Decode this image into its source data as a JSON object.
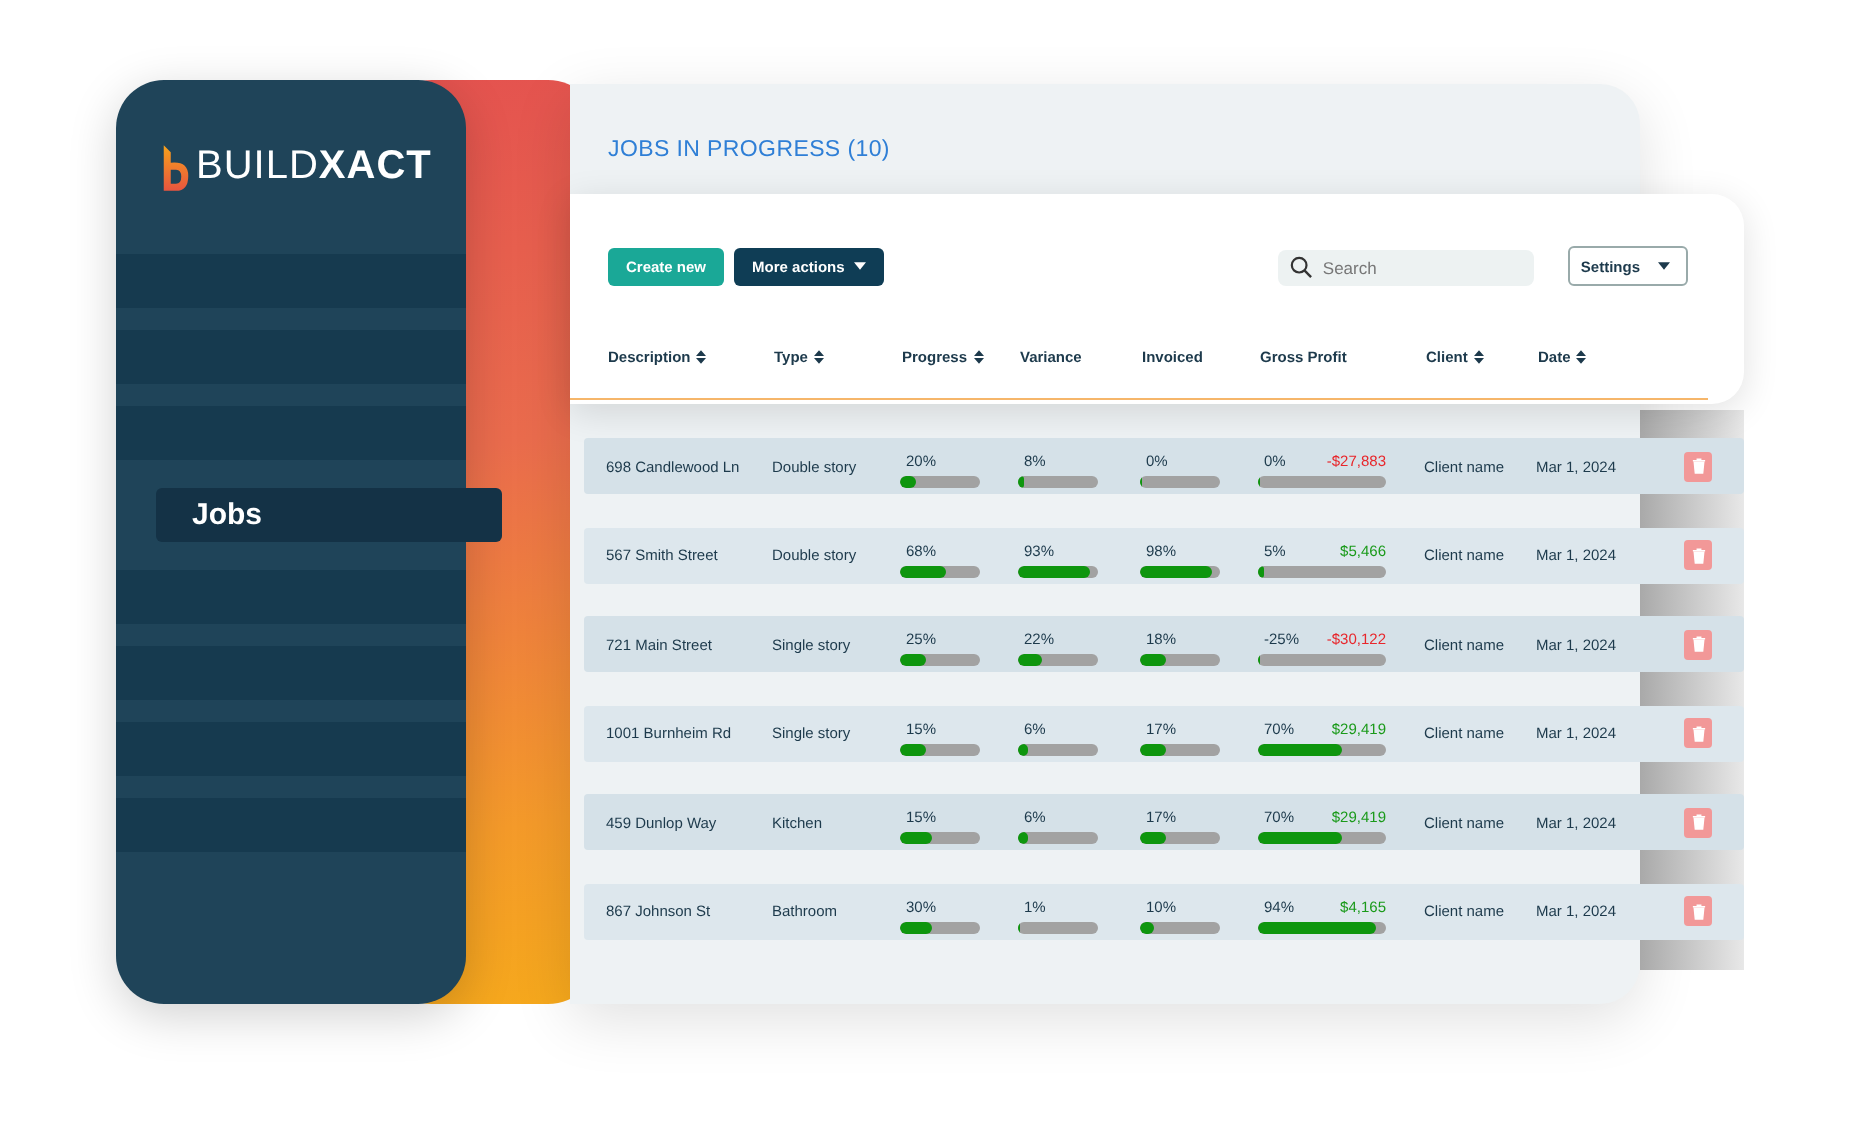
{
  "logo": {
    "text": "BUILD**XACT**"
  },
  "sidebar": {
    "items": [
      {
        "label": "Jobs",
        "selected": true
      }
    ]
  },
  "title": "JOBS IN PROGRESS (10)",
  "toolbar": {
    "create_button": "Create new",
    "actions_button": "More actions",
    "search": {
      "placeholder": "Search"
    },
    "settings_button": "Settings"
  },
  "table": {
    "columns": [
      {
        "label": "Description",
        "sortable": true
      },
      {
        "label": "Type",
        "sortable": true
      },
      {
        "label": "Progress",
        "sortable": true
      },
      {
        "label": "Variance",
        "sortable": false
      },
      {
        "label": "Invoiced",
        "sortable": false
      },
      {
        "label": "Gross Profit",
        "sortable": false
      },
      {
        "label": "Client",
        "sortable": true
      },
      {
        "label": "Date",
        "sortable": true
      }
    ],
    "rows": [
      {
        "description": "698 Candlewood Ln",
        "type": "Double story",
        "progress": {
          "text": "20%",
          "level": 0.2
        },
        "variance": {
          "text": "8%",
          "level": 0.08
        },
        "invoiced": {
          "text": "0%",
          "level": 0
        },
        "gross_profit": {
          "percent": "0%",
          "amount": "-$27,883",
          "color": "#e8262b",
          "level": 0
        },
        "client": "Client name",
        "date": "Mar 1, 2024"
      },
      {
        "description": "567 Smith Street",
        "type": "Double story",
        "progress": {
          "text": "68%",
          "level": 0.58
        },
        "variance": {
          "text": "93%",
          "level": 0.9
        },
        "invoiced": {
          "text": "98%",
          "level": 0.9
        },
        "gross_profit": {
          "percent": "5%",
          "amount": "$5,466",
          "color": "#1a9a1a",
          "level": 0.05
        },
        "client": "Client name",
        "date": "Mar 1, 2024"
      },
      {
        "description": "721 Main Street",
        "type": "Single story",
        "progress": {
          "text": "25%",
          "level": 0.32
        },
        "variance": {
          "text": "22%",
          "level": 0.3
        },
        "invoiced": {
          "text": "18%",
          "level": 0.32
        },
        "gross_profit": {
          "percent": "-25%",
          "amount": "-$30,122",
          "color": "#e8262b",
          "level": 0
        },
        "client": "Client name",
        "date": "Mar 1, 2024"
      },
      {
        "description": "1001 Burnheim Rd",
        "type": "Single story",
        "progress": {
          "text": "15%",
          "level": 0.32
        },
        "variance": {
          "text": "6%",
          "level": 0.12
        },
        "invoiced": {
          "text": "17%",
          "level": 0.32
        },
        "gross_profit": {
          "percent": "70%",
          "amount": "$29,419",
          "color": "#1a9a1a",
          "level": 0.66
        },
        "client": "Client name",
        "date": "Mar 1, 2024"
      },
      {
        "description": "459 Dunlop Way",
        "type": "Kitchen",
        "progress": {
          "text": "15%",
          "level": 0.4
        },
        "variance": {
          "text": "6%",
          "level": 0.12
        },
        "invoiced": {
          "text": "17%",
          "level": 0.32
        },
        "gross_profit": {
          "percent": "70%",
          "amount": "$29,419",
          "color": "#1a9a1a",
          "level": 0.66
        },
        "client": "Client name",
        "date": "Mar 1, 2024"
      },
      {
        "description": "867 Johnson St",
        "type": "Bathroom",
        "progress": {
          "text": "30%",
          "level": 0.4
        },
        "variance": {
          "text": "1%",
          "level": 0.01
        },
        "invoiced": {
          "text": "10%",
          "level": 0.18
        },
        "gross_profit": {
          "percent": "94%",
          "amount": "$4,165",
          "color": "#1a9a1a",
          "level": 0.92
        },
        "client": "Client name",
        "date": "Mar 1, 2024"
      }
    ]
  }
}
